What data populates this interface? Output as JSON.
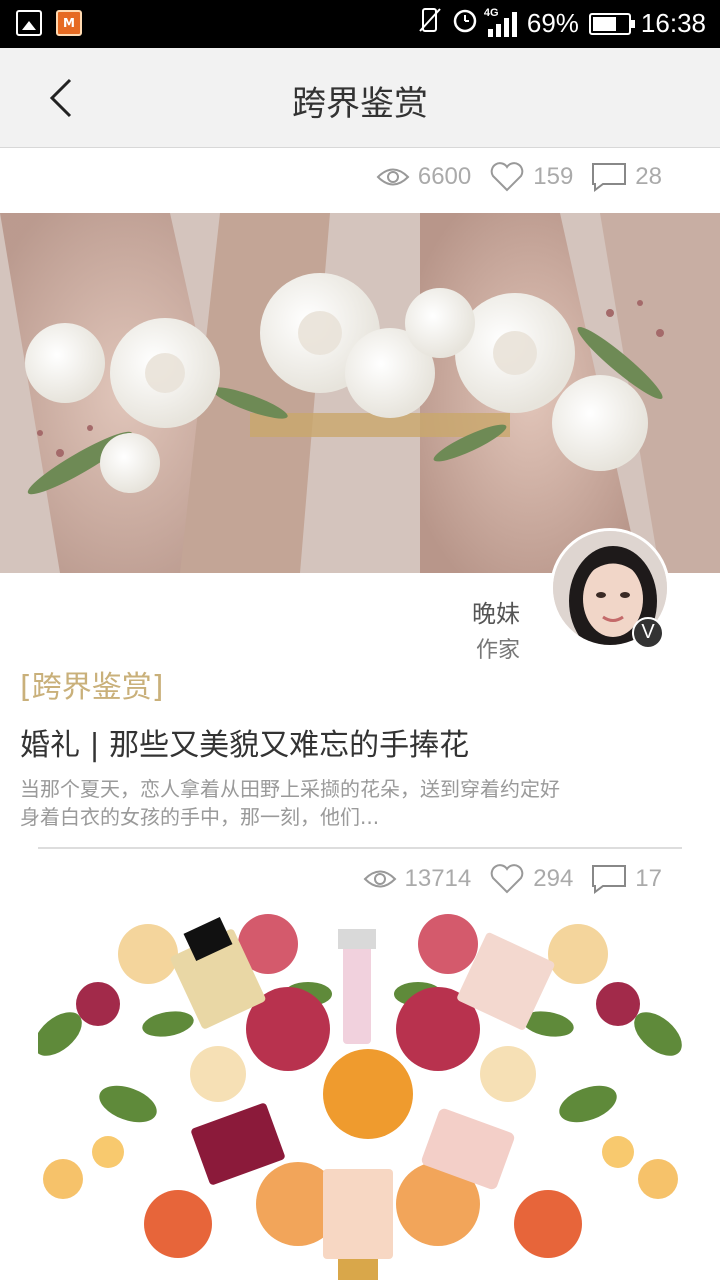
{
  "status_bar": {
    "battery": "69%",
    "battery_level": 0.69,
    "time": "16:38",
    "network": "4G"
  },
  "header": {
    "title": "跨界鉴赏"
  },
  "top_stats": {
    "views": "6600",
    "likes": "159",
    "comments": "28"
  },
  "article": {
    "author_name": "晚妹",
    "author_role": "作家",
    "verified_badge": "V",
    "category": "[跨界鉴赏]",
    "title": "婚礼 | 那些又美貌又难忘的手捧花",
    "summary_line1": "当那个夏天，恋人拿着从田野上采撷的花朵，送到穿着约定好",
    "summary_line2": "身着白衣的女孩的手中，那一刻，他们..."
  },
  "next_article": {
    "views": "13714",
    "likes": "294",
    "comments": "17"
  },
  "icons": {
    "back": "chevron-left-icon",
    "views": "eye-icon",
    "likes": "heart-icon",
    "comments": "comment-icon"
  },
  "colors": {
    "category": "#c9b07a",
    "header_bg": "#f2f2f2",
    "stat_gray": "#aaaaaa"
  }
}
